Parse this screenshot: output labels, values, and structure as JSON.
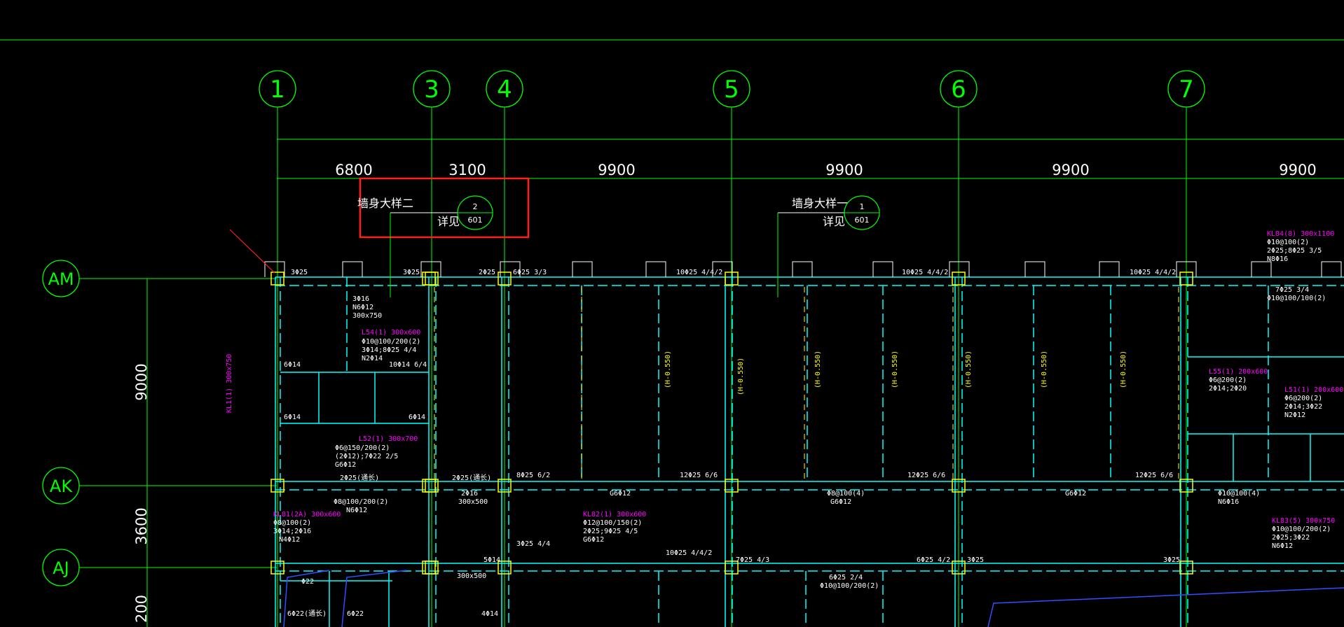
{
  "colors": {
    "background": "#000000",
    "grid": "#00ff00",
    "beam": "#00ffff",
    "annotation_magenta": "#ff00ff",
    "annotation_yellow": "#ffff00",
    "annotation_white": "#ffffff",
    "highlight_box": "#ff2020",
    "column": "#ffff00",
    "blue_line": "#0000ff"
  },
  "axes_vertical": [
    "1",
    "3",
    "4",
    "5",
    "6",
    "7"
  ],
  "axes_horizontal": [
    "AM",
    "AK",
    "AJ"
  ],
  "dimensions_top": [
    "6800",
    "3100",
    "9900",
    "9900",
    "9900",
    "9900"
  ],
  "dimensions_left": [
    "9000",
    "3600",
    "200"
  ],
  "details": [
    {
      "title": "墙身大样二",
      "ref": "详见",
      "num": "2",
      "sheet": "601"
    },
    {
      "title": "墙身大样一",
      "ref": "详见",
      "num": "1",
      "sheet": "601"
    }
  ],
  "top_rebar": [
    "3Φ25",
    "3Φ25",
    "2Φ25",
    "6Φ25 3/3",
    "10Φ25 4/4/2",
    "10Φ25 4/4/2",
    "10Φ25 4/4/2"
  ],
  "ak_rebar": [
    "2Φ25(通长)",
    "2Φ25(通长)",
    "8Φ25 6/2",
    "12Φ25 6/6",
    "12Φ25 6/6",
    "12Φ25 6/6"
  ],
  "aj_rebar": [
    "5Φ14",
    "10Φ25 4/4/2",
    "7Φ25 4/3",
    "6Φ25 4/2",
    "3Φ25",
    "3Φ25"
  ],
  "beam_labels_magenta": [
    "KL84(8) 300x1100",
    "L54(1) 300x600",
    "L52(1) 300x700",
    "KL81(2A) 300x600",
    "KL82(1) 300x600",
    "KL83(5) 300x750",
    "L55(1) 200x600",
    "L51(1) 200x600",
    "KL1(1) 300x750"
  ],
  "beam_labels_white": [
    "3Φ16",
    "N6Φ12",
    "300x750",
    "Φ10@100/200(2)",
    "3Φ14;8Φ25 4/4",
    "N2Φ14",
    "Φ6@150/200(2)",
    "(2Φ12);7Φ22 2/5",
    "G6Φ12",
    "Φ8@100/200(2)",
    "N6Φ12",
    "2Φ16",
    "300x500",
    "Φ8@100(2)",
    "3Φ14;2Φ16",
    "N4Φ12",
    "Φ12@100/150(2)",
    "2Φ25;9Φ25 4/5",
    "G6Φ12",
    "Φ8@100(4)",
    "G6Φ12",
    "Φ10@100(4)",
    "N6Φ16",
    "Φ10@100/200(2)",
    "2Φ25;3Φ22",
    "N6Φ12",
    "6Φ25 2/4",
    "Φ10@100/200(2)",
    "Φ10@100(2)",
    "2Φ25;8Φ25 3/5",
    "N8Φ16",
    "Φ6@200(2)",
    "2Φ14;2Φ20",
    "Φ6@200(2)",
    "2Φ14;3Φ22",
    "N2Φ12",
    "6Φ14",
    "6Φ14",
    "6Φ14",
    "10Φ14 6/4",
    "7Φ25 3/4",
    "Φ10@100/100(2)",
    "300x500",
    "3Φ25 4/4",
    "Φ22",
    "6Φ22",
    "6Φ22(通长)",
    "4Φ14",
    "G6Φ12",
    "G6Φ12"
  ],
  "vertical_labels_yellow": [
    "(H-0.550)",
    "(H-0.550)",
    "(H-0.550)",
    "(H-0.550)",
    "(H-0.550)",
    "(H-0.550)",
    "(H-0.550)"
  ]
}
